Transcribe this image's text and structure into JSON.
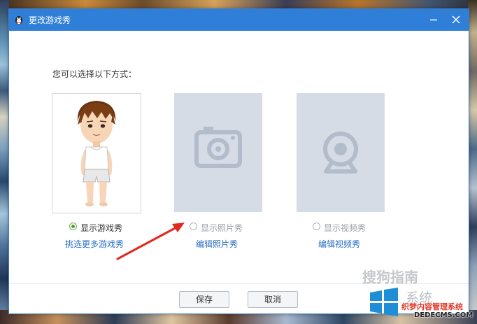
{
  "dialog": {
    "title": "更改游戏秀",
    "prompt": "您可以选择以下方式："
  },
  "options": [
    {
      "label": "显示游戏秀",
      "link": "挑选更多游戏秀",
      "selected": true,
      "enabled": true
    },
    {
      "label": "显示照片秀",
      "link": "编辑照片秀",
      "selected": false,
      "enabled": false
    },
    {
      "label": "显示视频秀",
      "link": "编辑视频秀",
      "selected": false,
      "enabled": false
    }
  ],
  "buttons": {
    "save": "保存",
    "cancel": "取消"
  },
  "watermarks": {
    "sogou": "搜狗指南",
    "brand_partial": "系统",
    "dede_cn": "织梦内容管理系统",
    "dede_url": "DEDECMS.COM"
  },
  "colors": {
    "titlebar": "#2f7fd8",
    "link": "#2a6fc4",
    "radio_selected": "#4e9a2e",
    "placeholder_bg": "#d6dce5",
    "placeholder_icon": "#b2bccb",
    "arrow": "#e02a1e"
  },
  "icons": {
    "title": "qq-penguin-icon",
    "photo": "camera-icon",
    "video": "webcam-icon"
  }
}
